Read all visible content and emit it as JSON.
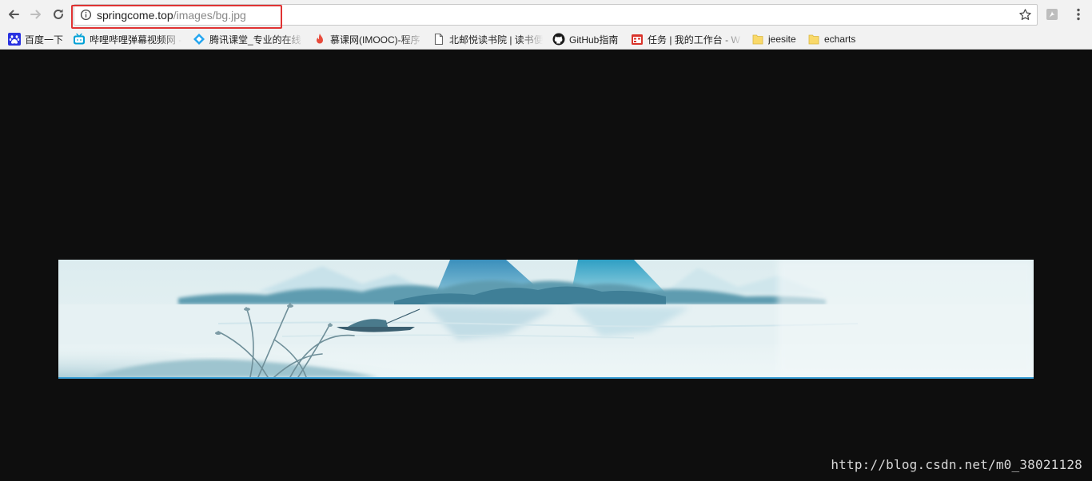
{
  "toolbar": {
    "url_host": "springcome.top",
    "url_path": "/images/bg.jpg"
  },
  "bookmarks": [
    {
      "label": "百度一下",
      "icon": "baidu-paw-icon"
    },
    {
      "label": "哔哩哔哩弹幕视频网 -",
      "icon": "bilibili-tv-icon"
    },
    {
      "label": "腾讯课堂_专业的在线",
      "icon": "tencent-ketang-icon"
    },
    {
      "label": "慕课网(IMOOC)-程序",
      "icon": "imooc-flame-icon"
    },
    {
      "label": "北邮悦读书院 | 读书便",
      "icon": "page-icon"
    },
    {
      "label": "GitHub指南",
      "icon": "github-icon"
    },
    {
      "label": "任务 | 我的工作台 - W",
      "icon": "task-calendar-icon"
    },
    {
      "label": "jeesite",
      "icon": "folder-icon"
    },
    {
      "label": "echarts",
      "icon": "folder-icon"
    }
  ],
  "watermark": "http://blog.csdn.net/m0_38021128",
  "colors": {
    "highlight_box": "#e03333",
    "page_background": "#0e0e0e",
    "banner_mountain": "#2f8fbf",
    "banner_border": "#3a9fd6"
  }
}
